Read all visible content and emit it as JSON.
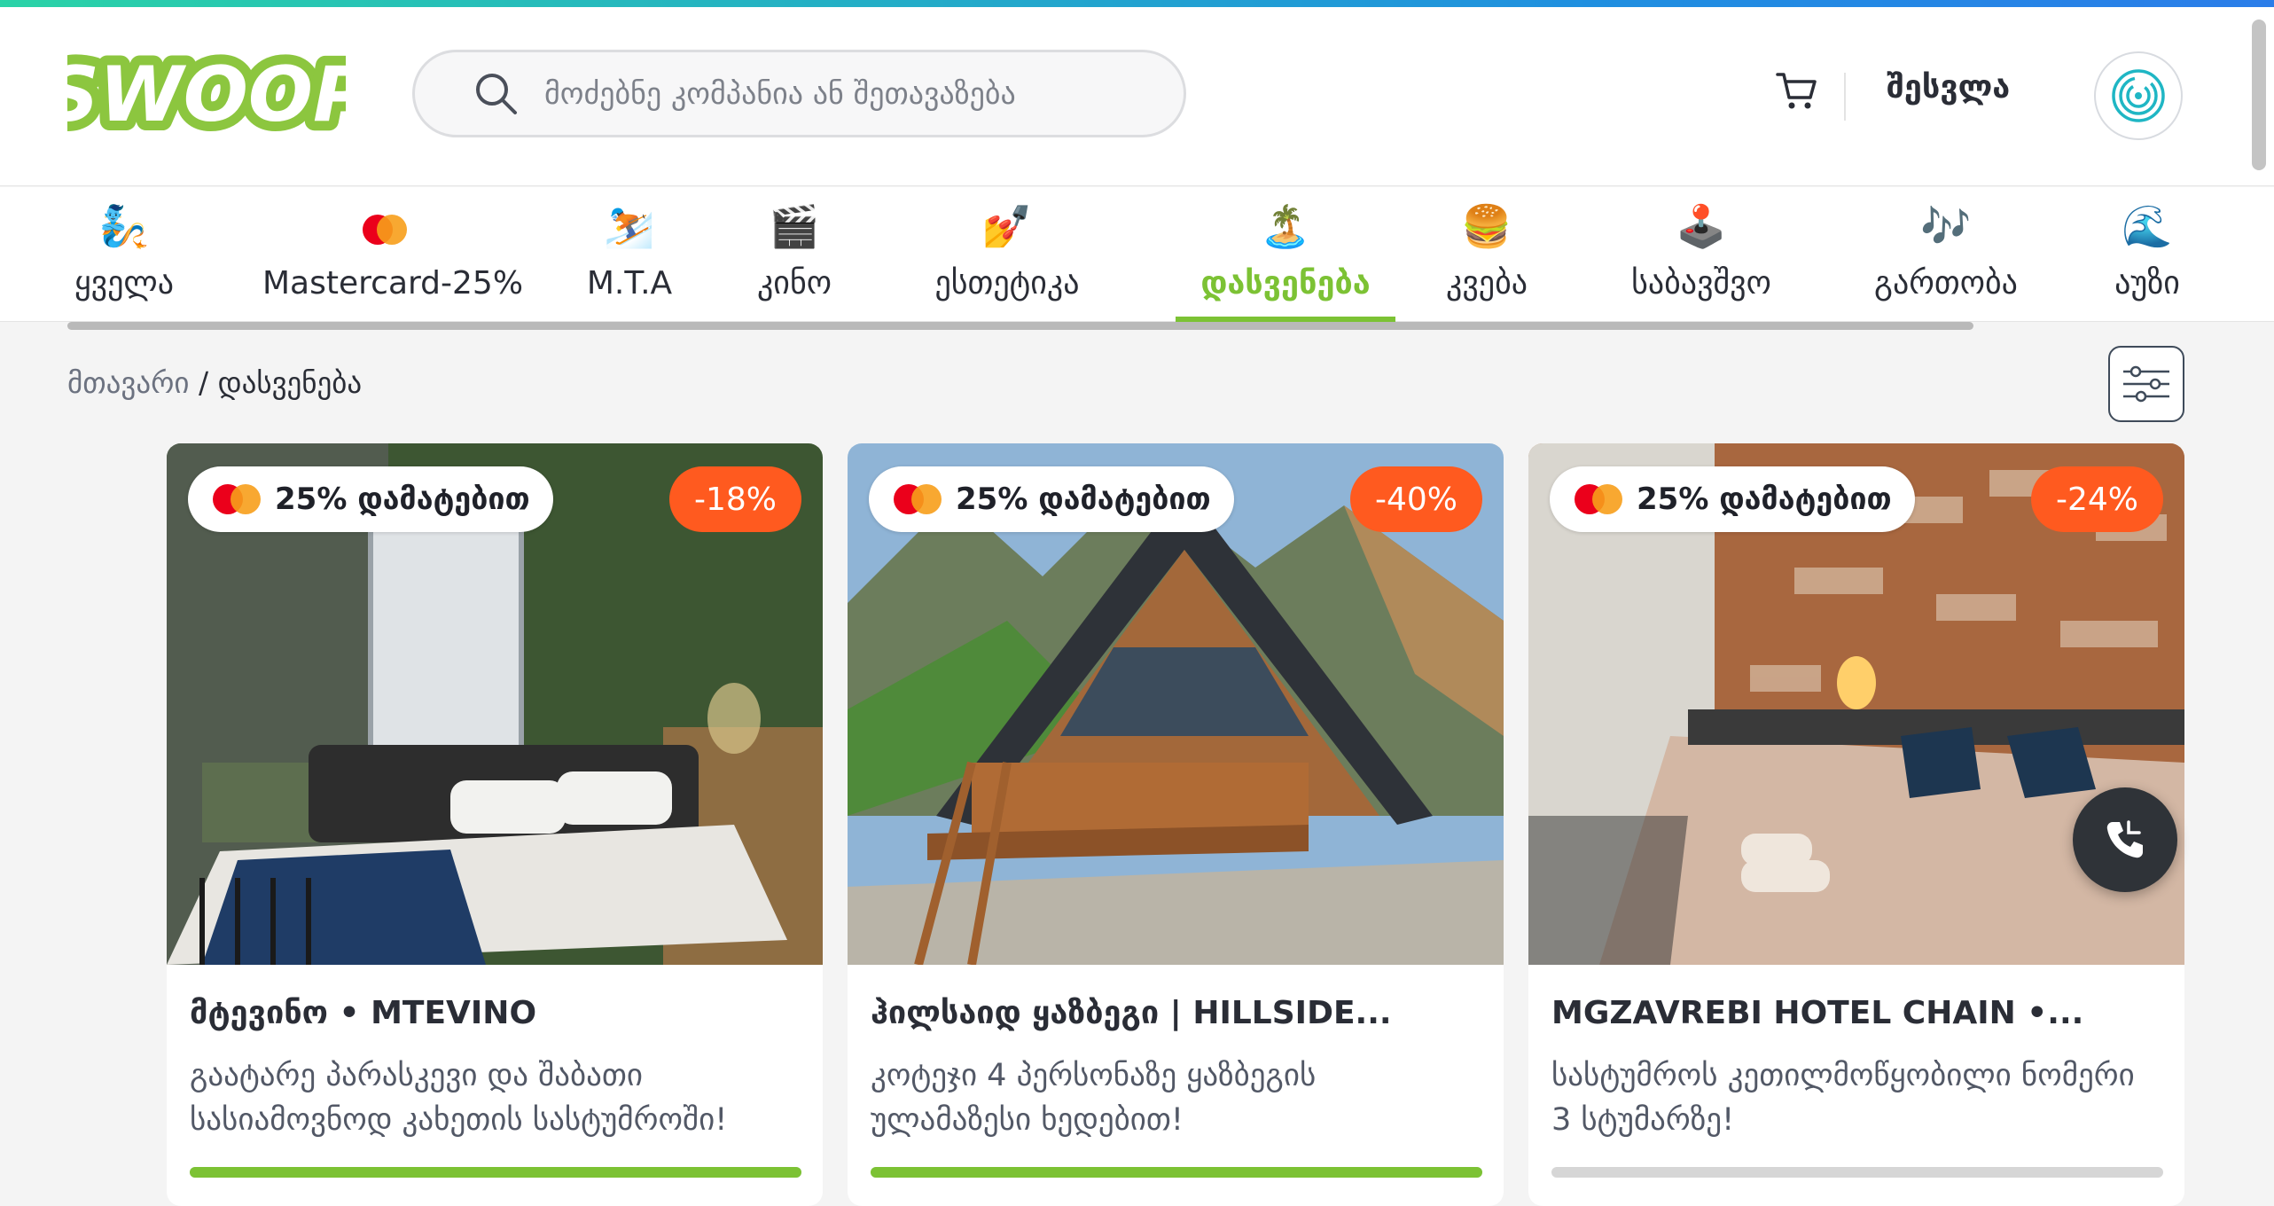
{
  "header": {
    "logo_text": "SWOOP",
    "search_placeholder": "მოძებნე კომპანია ან შეთავაზება",
    "login_label": "შესვლა"
  },
  "categories": [
    {
      "emoji": "🧞",
      "label": "ყველა",
      "active": false
    },
    {
      "emoji": "💳",
      "label": "Mastercard-25%",
      "active": false
    },
    {
      "emoji": "⛷️",
      "label": "M.T.A",
      "active": false
    },
    {
      "emoji": "🎬",
      "label": "კინო",
      "active": false
    },
    {
      "emoji": "💅",
      "label": "ესთეტიკა",
      "active": false
    },
    {
      "emoji": "🏝️",
      "label": "დასვენება",
      "active": true
    },
    {
      "emoji": "🍔",
      "label": "კვება",
      "active": false
    },
    {
      "emoji": "🕹️",
      "label": "საბავშვო",
      "active": false
    },
    {
      "emoji": "🎶",
      "label": "გართობა",
      "active": false
    },
    {
      "emoji": "🌊",
      "label": "აუზი",
      "active": false
    }
  ],
  "breadcrumb": {
    "home": "მთავარი",
    "separator": "/",
    "current": "დასვენება"
  },
  "cards": [
    {
      "promo": "25% დამატებით",
      "discount": "-18%",
      "title": "მტევინო • MTEVINO",
      "desc": "გაატარე პარასკევი და შაბათი სასიამოვნოდ კახეთის სასტუმროში!",
      "progress": 1.0
    },
    {
      "promo": "25% დამატებით",
      "discount": "-40%",
      "title": "ჰილსაიდ ყაზბეგი | HILLSIDE...",
      "desc": "კოტეჯი 4 პერსონაზე ყაზბეგის ულამაზესი ხედებით!",
      "progress": 1.0
    },
    {
      "promo": "25% დამატებით",
      "discount": "-24%",
      "title": "MGZAVREBI HOTEL CHAIN •...",
      "desc": "სასტუმროს კეთილმოწყობილი ნომერი 3 სტუმარზე!",
      "progress": 0.0
    }
  ],
  "colors": {
    "brand_green": "#7cc234",
    "discount_orange": "#ff5a1f",
    "text_dark": "#2a2d36"
  }
}
